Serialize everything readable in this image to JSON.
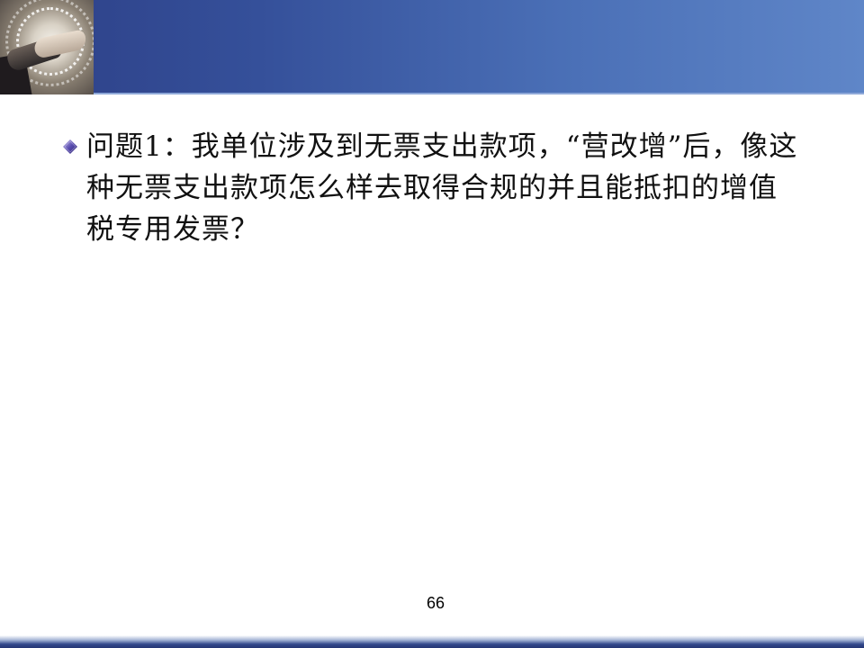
{
  "slide": {
    "body": {
      "bullet_icon": "diamond-bullet-icon",
      "items": [
        {
          "text": "问题1：我单位涉及到无票支出款项，“营改增”后，像这种无票支出款项怎么样去取得合规的并且能抵扣的增值税专用发票？"
        }
      ]
    },
    "page_number": "66"
  },
  "colors": {
    "header_dark": "#2d3f86",
    "header_light": "#5f86c8",
    "bullet_purple": "#5a4db0",
    "text": "#111111"
  }
}
